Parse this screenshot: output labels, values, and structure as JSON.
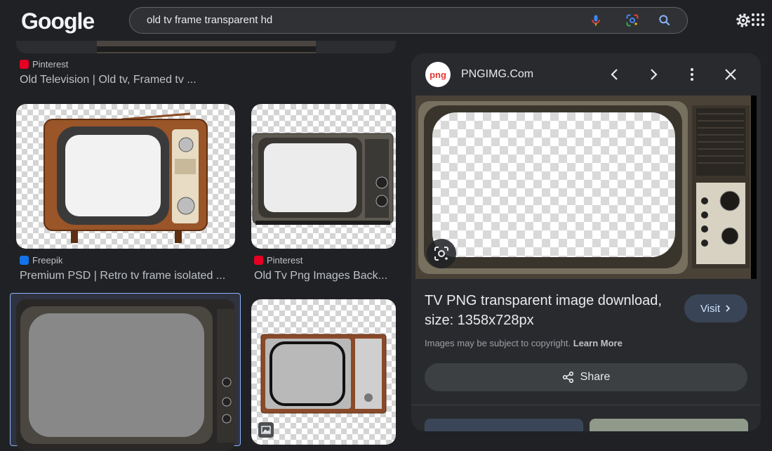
{
  "header": {
    "logo": "Google",
    "search_value": "old tv frame transparent hd",
    "icons": [
      "mic-icon",
      "lens-icon",
      "search-icon",
      "gear-icon",
      "apps-icon"
    ]
  },
  "results": [
    {
      "source": "Pinterest",
      "title": "Old Television | Old tv, Framed tv ...",
      "favicon_color": "#e60023"
    },
    {
      "source": "Freepik",
      "title": "Premium PSD | Retro tv frame isolated ...",
      "favicon_color": "#1273eb"
    },
    {
      "source": "Pinterest",
      "title": "Old Tv Png Images Back...",
      "favicon_color": "#e60023"
    }
  ],
  "panel": {
    "site_logo_text": "png",
    "site_name": "PNGIMG.Com",
    "title": "TV PNG transparent image download, size: 1358x728px",
    "copyright": "Images may be subject to copyright.",
    "learn_more": "Learn More",
    "visit_label": "Visit",
    "share_label": "Share"
  },
  "colors": {
    "background": "#202124",
    "panel": "#292a2d",
    "visit_bg": "#394457",
    "selected_border": "#8ab4f8"
  }
}
